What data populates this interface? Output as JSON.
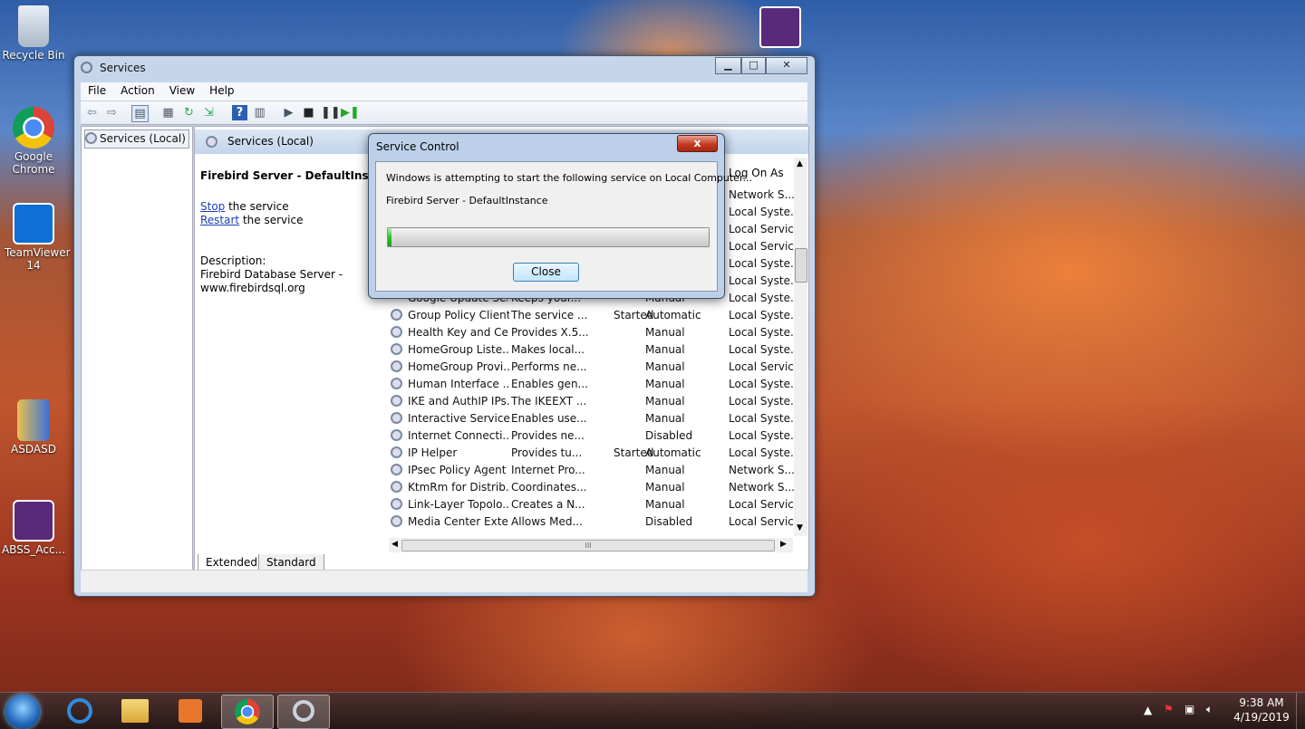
{
  "desktop": {
    "icons": [
      {
        "label": "Recycle Bin",
        "icon": "recycle-bin-icon"
      },
      {
        "label": "Google Chrome",
        "icon": "chrome-icon"
      },
      {
        "label": "TeamViewer 14",
        "icon": "teamviewer-icon"
      },
      {
        "label": "ASDASD",
        "icon": "folder-icon"
      },
      {
        "label": "ABSS_Acc...",
        "icon": "abss-calculator-icon"
      }
    ]
  },
  "window": {
    "title": "Services",
    "menu": [
      "File",
      "Action",
      "View",
      "Help"
    ],
    "tree_item": "Services (Local)",
    "header_title": "Services (Local)",
    "service_name": "Firebird Server - DefaultInstance",
    "stop_link": "Stop",
    "stop_suffix": " the service",
    "restart_link": "Restart",
    "restart_suffix": " the service",
    "description_label": "Description:",
    "description_line1": "Firebird Database Server -",
    "description_line2": "www.firebirdsql.org",
    "column_logon": "Log On As",
    "tabs": [
      "Extended",
      "Standard"
    ],
    "scroll_indicator": "III"
  },
  "partial_rows": [
    {
      "logon": "Network S..."
    },
    {
      "logon": "Local Syste..."
    },
    {
      "logon": "Local Service"
    },
    {
      "logon": "Local Service"
    },
    {
      "logon": "Local Syste..."
    },
    {
      "logon": "Local Syste..."
    }
  ],
  "cut_row": {
    "name": "Google Update Ser...",
    "desc": "Keeps your...",
    "startup": "Manual",
    "logon": "Local Syste..."
  },
  "services": [
    {
      "name": "Group Policy Client",
      "desc": "The service ...",
      "status": "Started",
      "startup": "Automatic",
      "logon": "Local Syste..."
    },
    {
      "name": "Health Key and Ce...",
      "desc": "Provides X.5...",
      "status": "",
      "startup": "Manual",
      "logon": "Local Syste..."
    },
    {
      "name": "HomeGroup Liste...",
      "desc": "Makes local...",
      "status": "",
      "startup": "Manual",
      "logon": "Local Syste..."
    },
    {
      "name": "HomeGroup Provi...",
      "desc": "Performs ne...",
      "status": "",
      "startup": "Manual",
      "logon": "Local Service"
    },
    {
      "name": "Human Interface ...",
      "desc": "Enables gen...",
      "status": "",
      "startup": "Manual",
      "logon": "Local Syste..."
    },
    {
      "name": "IKE and AuthIP IPs...",
      "desc": "The IKEEXT ...",
      "status": "",
      "startup": "Manual",
      "logon": "Local Syste..."
    },
    {
      "name": "Interactive Service...",
      "desc": "Enables use...",
      "status": "",
      "startup": "Manual",
      "logon": "Local Syste..."
    },
    {
      "name": "Internet Connecti...",
      "desc": "Provides ne...",
      "status": "",
      "startup": "Disabled",
      "logon": "Local Syste..."
    },
    {
      "name": "IP Helper",
      "desc": "Provides tu...",
      "status": "Started",
      "startup": "Automatic",
      "logon": "Local Syste..."
    },
    {
      "name": "IPsec Policy Agent",
      "desc": "Internet Pro...",
      "status": "",
      "startup": "Manual",
      "logon": "Network S..."
    },
    {
      "name": "KtmRm for Distrib...",
      "desc": "Coordinates...",
      "status": "",
      "startup": "Manual",
      "logon": "Network S..."
    },
    {
      "name": "Link-Layer Topolo...",
      "desc": "Creates a N...",
      "status": "",
      "startup": "Manual",
      "logon": "Local Service"
    },
    {
      "name": "Media Center Exte...",
      "desc": "Allows Med...",
      "status": "",
      "startup": "Disabled",
      "logon": "Local Service"
    }
  ],
  "dialog": {
    "title": "Service Control",
    "close_x": "x",
    "message": "Windows is attempting to start the following service on Local Computer...",
    "service": "Firebird Server - DefaultInstance",
    "progress": 0.01,
    "close_button": "Close"
  },
  "taskbar": {
    "time": "9:38 AM",
    "date": "4/19/2019",
    "apps": [
      "internet-explorer-icon",
      "file-explorer-icon",
      "media-player-icon",
      "chrome-icon",
      "services-gear-icon"
    ]
  }
}
